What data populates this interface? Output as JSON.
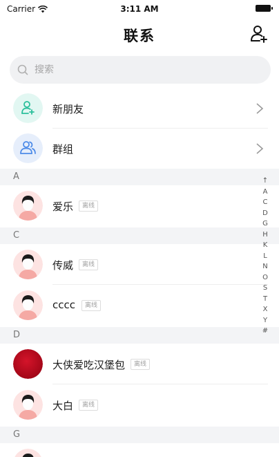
{
  "status_bar": {
    "carrier": "Carrier",
    "time": "3:11 AM"
  },
  "nav": {
    "title": "联系",
    "add_icon": "add-user-icon"
  },
  "search": {
    "placeholder": "搜索"
  },
  "menu": [
    {
      "label": "新朋友",
      "icon": "add-user-icon",
      "color": "#2bbf9b",
      "bg": "#e2f7f2"
    },
    {
      "label": "群组",
      "icon": "group-icon",
      "color": "#4d8be8",
      "bg": "#e6eefb"
    }
  ],
  "sections": [
    {
      "letter": "A",
      "contacts": [
        {
          "name": "爱乐",
          "status": "离线",
          "avatar": "default"
        }
      ]
    },
    {
      "letter": "C",
      "contacts": [
        {
          "name": "传威",
          "status": "离线",
          "avatar": "default"
        },
        {
          "name": "cccc",
          "status": "离线",
          "avatar": "default"
        }
      ]
    },
    {
      "letter": "D",
      "contacts": [
        {
          "name": "大侠爱吃汉堡包",
          "status": "离线",
          "avatar": "red"
        },
        {
          "name": "大白",
          "status": "离线",
          "avatar": "default"
        }
      ]
    },
    {
      "letter": "G",
      "contacts": []
    }
  ],
  "index_letters": [
    "↑",
    "A",
    "C",
    "D",
    "G",
    "H",
    "K",
    "L",
    "N",
    "O",
    "S",
    "T",
    "X",
    "Y",
    "#"
  ]
}
